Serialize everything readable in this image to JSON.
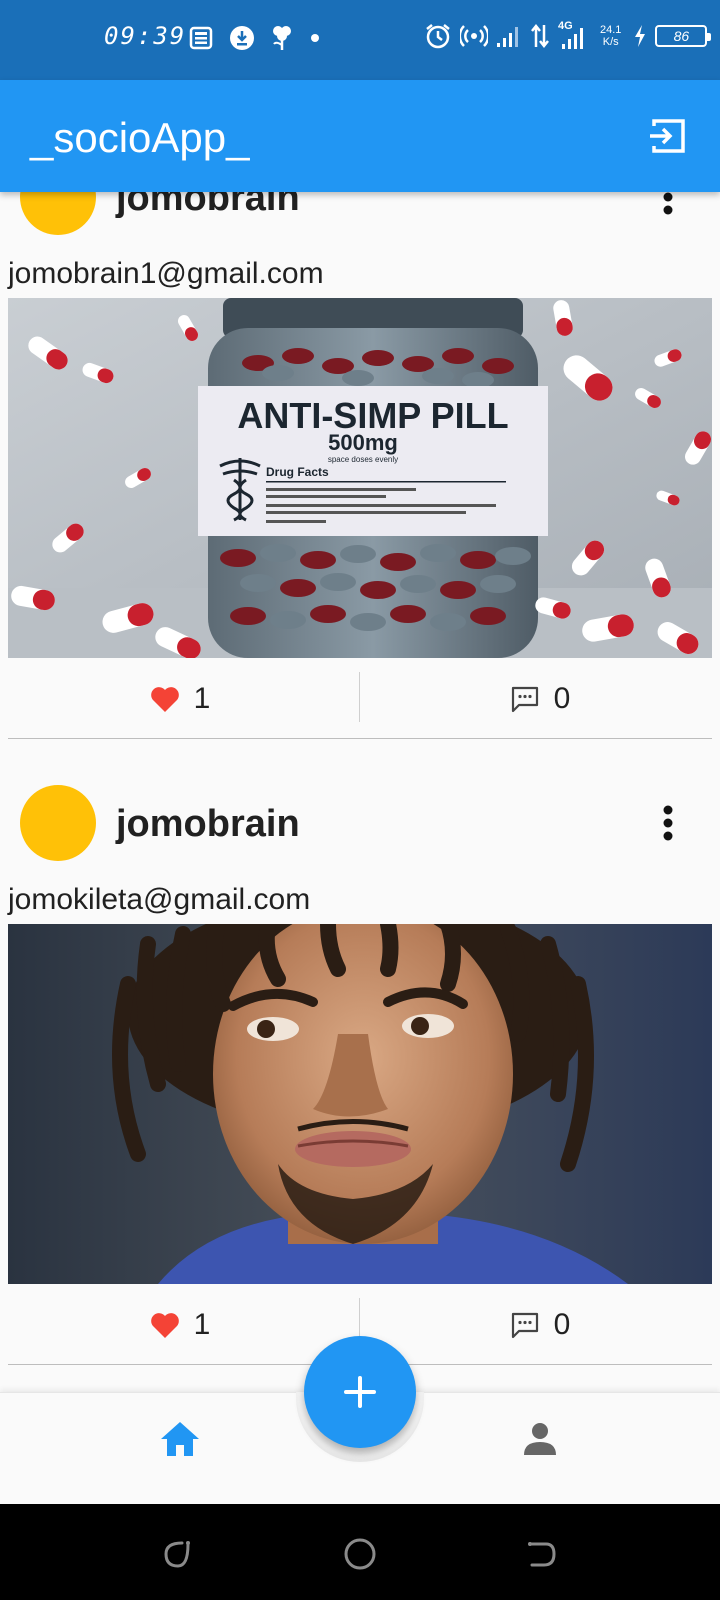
{
  "status_bar": {
    "time": "09:39",
    "network_type": "4G",
    "speed_value": "24.1",
    "speed_unit": "K/s",
    "battery": "86"
  },
  "app_bar": {
    "title": "_socioApp_"
  },
  "posts": [
    {
      "username": "jomobrain",
      "email": "jomobrain1@gmail.com",
      "image": {
        "label_title": "ANTI-SIMP PILL",
        "label_dose": "500mg",
        "label_sub": "space doses evenly",
        "label_facts": "Drug Facts"
      },
      "likes": "1",
      "comments": "0"
    },
    {
      "username": "jomobrain",
      "email": "jomokileta@gmail.com",
      "likes": "1",
      "comments": "0"
    }
  ],
  "colors": {
    "primary": "#2196f3",
    "status_bar": "#1a6fb8",
    "avatar": "#ffc107",
    "like": "#f44336"
  },
  "icons": {
    "logout": "logout-icon",
    "more": "more-vertical-icon",
    "like": "heart-icon",
    "comment": "comment-icon",
    "add": "plus-icon",
    "home": "home-icon",
    "profile": "person-icon"
  }
}
